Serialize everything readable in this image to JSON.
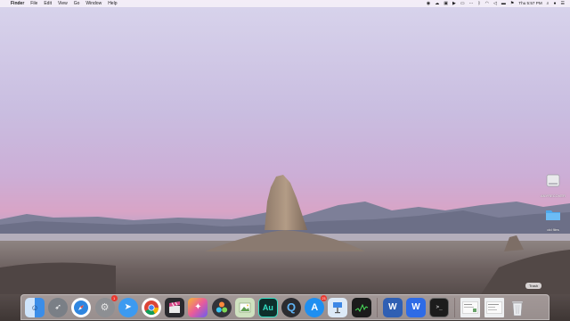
{
  "menubar": {
    "app_name": "Finder",
    "menus": [
      "File",
      "Edit",
      "View",
      "Go",
      "Window",
      "Help"
    ],
    "clock": "Thu 5:57 PM"
  },
  "desktop": {
    "items": [
      {
        "label": "ANYRECOVER",
        "icon": "external-drive-icon"
      },
      {
        "label": "old files",
        "icon": "folder-icon"
      }
    ]
  },
  "dock": {
    "apps": [
      {
        "name": "finder",
        "icon": "finder-icon",
        "color": "#3b8de8"
      },
      {
        "name": "launchpad",
        "icon": "rocket-icon",
        "color": "#7a7f86"
      },
      {
        "name": "safari",
        "icon": "compass-icon",
        "color": "#2f86e0"
      },
      {
        "name": "system-preferences",
        "icon": "gear-icon",
        "color": "#8d8f93",
        "badge": "1"
      },
      {
        "name": "mail",
        "icon": "paper-plane-icon",
        "color": "#3c9af0"
      },
      {
        "name": "chrome",
        "icon": "chrome-icon",
        "color": "#ffffff"
      },
      {
        "name": "final-cut-pro",
        "icon": "clapper-icon",
        "color": "#2a2a2e"
      },
      {
        "name": "motion",
        "icon": "gradient-icon",
        "color": "#c85bd1"
      },
      {
        "name": "davinci-resolve",
        "icon": "resolve-icon",
        "color": "#333339"
      },
      {
        "name": "preview",
        "icon": "photos-icon",
        "color": "#8fb07a"
      },
      {
        "name": "audition",
        "icon": "au-icon",
        "color": "#0e2e2b",
        "text": "Au"
      },
      {
        "name": "quicktime",
        "icon": "q-icon",
        "color": "#2b2b30",
        "text": "Q"
      },
      {
        "name": "app-store",
        "icon": "a-icon",
        "color": "#1f8ff0",
        "badge": "21"
      },
      {
        "name": "keynote",
        "icon": "podium-icon",
        "color": "#3d87e5"
      },
      {
        "name": "activity-monitor",
        "icon": "monitor-icon",
        "color": "#1b1b1b"
      },
      {
        "name": "word",
        "icon": "w-icon",
        "color": "#2f5fb3",
        "text": "W"
      },
      {
        "name": "wps-office",
        "icon": "wps-icon",
        "color": "#2e6be6",
        "text": "W"
      },
      {
        "name": "terminal",
        "icon": "terminal-icon",
        "color": "#1c1c1c",
        "text": ">_"
      }
    ],
    "stack_items": [
      {
        "name": "recent-doc-1",
        "icon": "document-thumbnail-icon"
      },
      {
        "name": "recent-doc-2",
        "icon": "document-thumbnail-icon"
      }
    ],
    "trash": {
      "icon": "trash-icon",
      "tooltip": "Trash"
    }
  }
}
